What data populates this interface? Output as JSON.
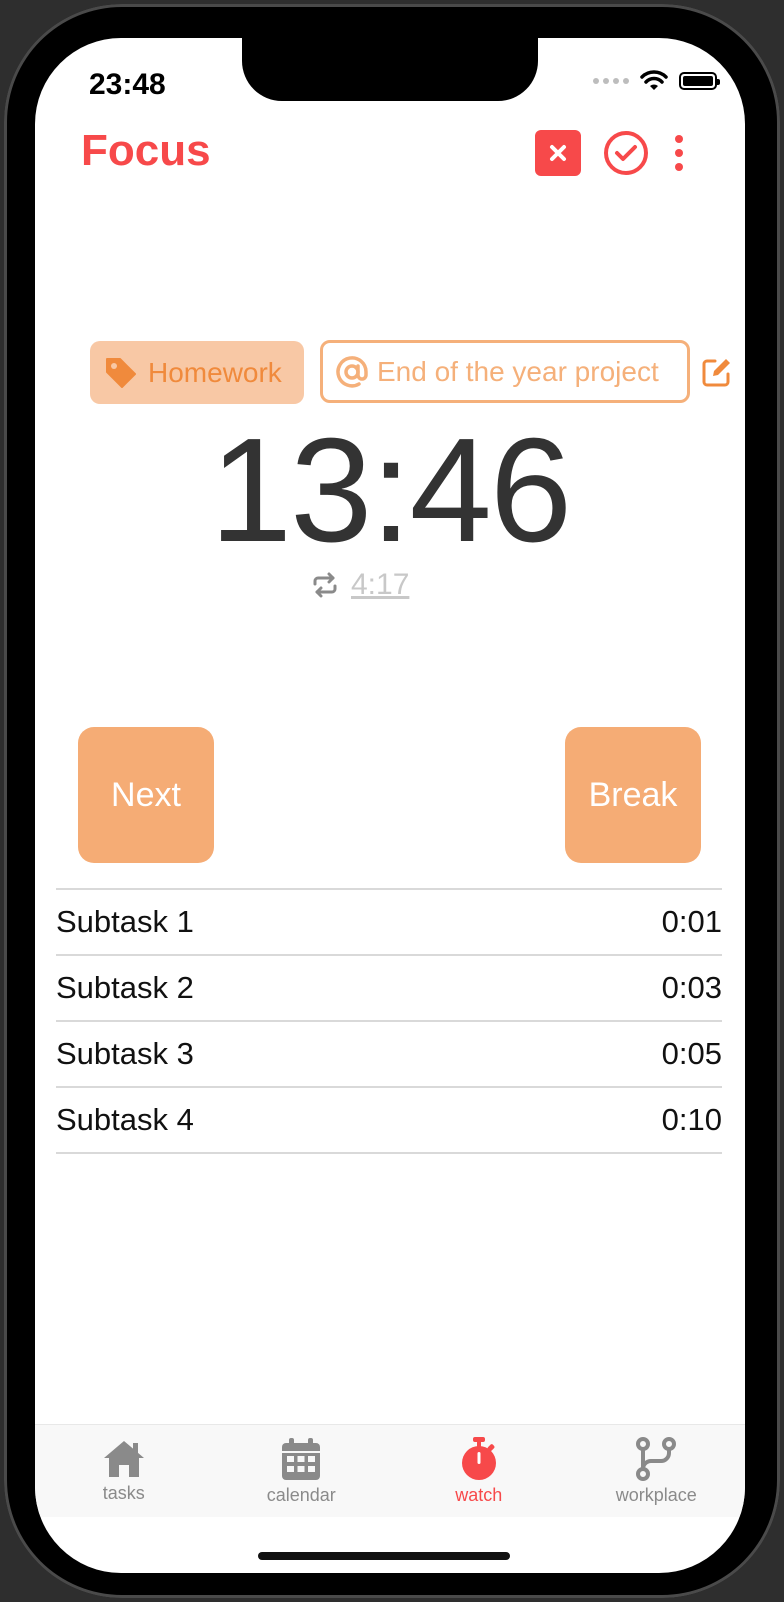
{
  "status_bar": {
    "time": "23:48"
  },
  "header": {
    "title": "Focus"
  },
  "tag": {
    "label": "Homework"
  },
  "project": {
    "label": "End of the year project"
  },
  "timer": {
    "main": "13:46",
    "secondary": "4:17"
  },
  "actions": {
    "next_label": "Next",
    "break_label": "Break"
  },
  "subtasks": [
    {
      "name": "Subtask 1",
      "time": "0:01"
    },
    {
      "name": "Subtask 2",
      "time": "0:03"
    },
    {
      "name": "Subtask 3",
      "time": "0:05"
    },
    {
      "name": "Subtask 4",
      "time": "0:10"
    }
  ],
  "tabs": [
    {
      "label": "tasks",
      "icon": "home-icon"
    },
    {
      "label": "calendar",
      "icon": "calendar-icon"
    },
    {
      "label": "watch",
      "icon": "stopwatch-icon",
      "active": true
    },
    {
      "label": "workplace",
      "icon": "branch-icon"
    }
  ],
  "colors": {
    "accent": "#f7494a",
    "orange": "#f5ac75",
    "orange_text": "#f08a3c",
    "inactive": "#8a8a8a"
  }
}
